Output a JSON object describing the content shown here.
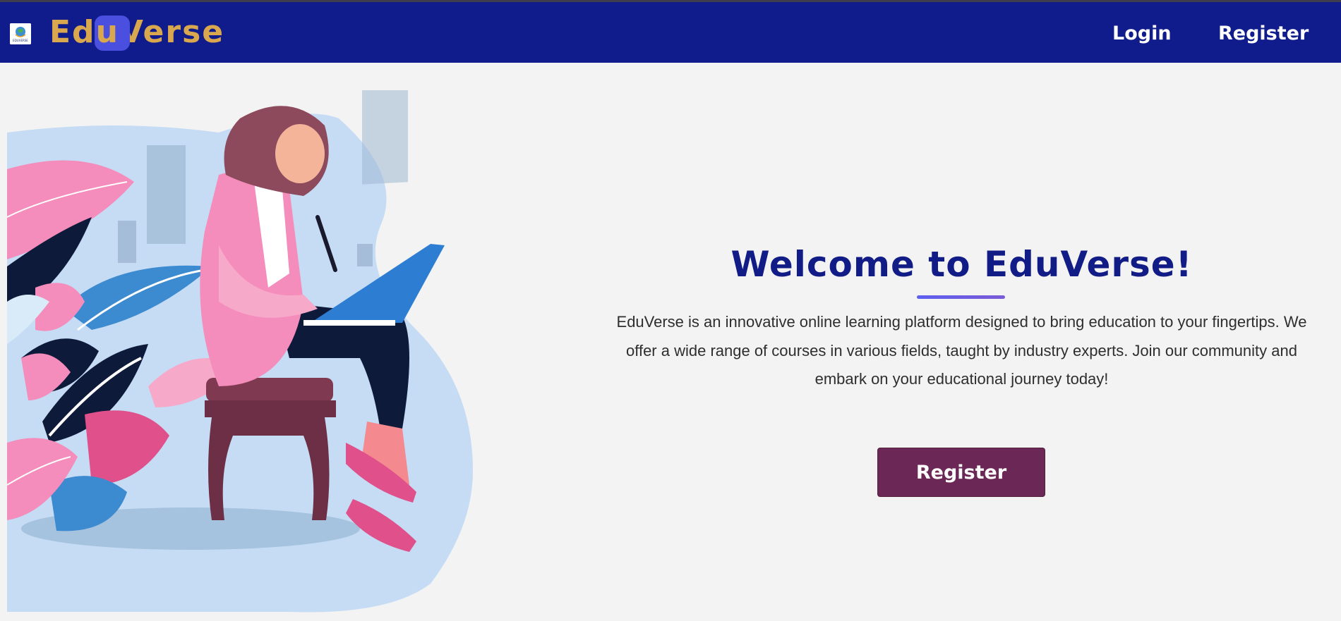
{
  "navbar": {
    "brand_part1": "Ed",
    "brand_highlight": "u",
    "brand_part2": "Verse",
    "logo_label": "EDUVERSE",
    "links": [
      {
        "label": "Login"
      },
      {
        "label": "Register"
      }
    ]
  },
  "hero": {
    "title": "Welcome to EduVerse!",
    "description": "EduVerse is an innovative online learning platform designed to bring education to your fingertips. We offer a wide range of courses in various fields, taught by industry experts. Join our community and embark on your educational journey today!",
    "cta_label": "Register"
  },
  "colors": {
    "navbar_bg": "#101c8c",
    "brand_gold": "#d9a84e",
    "brand_highlight": "#4b4fe0",
    "title_blue": "#111c86",
    "cta_bg": "#6b2755",
    "page_bg": "#f3f3f3"
  }
}
